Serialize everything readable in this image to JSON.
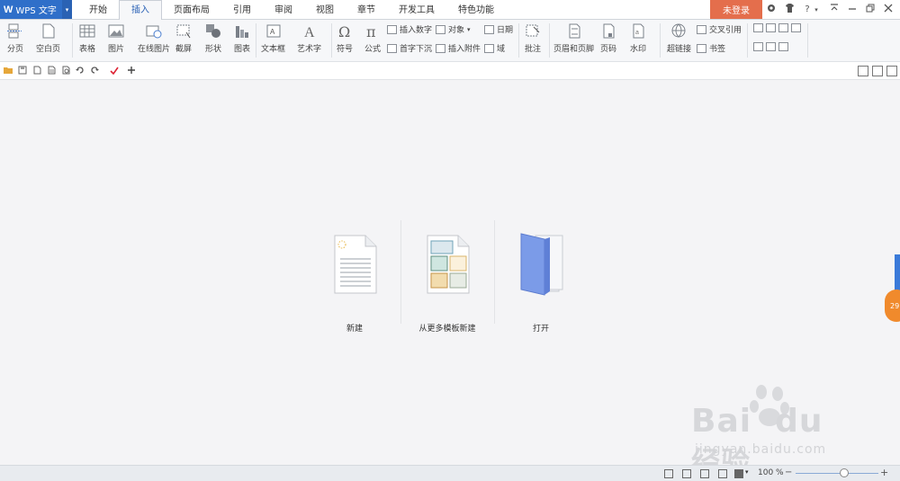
{
  "app": {
    "logo_text": "WPS 文字",
    "logo_w": "W"
  },
  "tabs": [
    "开始",
    "插入",
    "页面布局",
    "引用",
    "审阅",
    "视图",
    "章节",
    "开发工具",
    "特色功能"
  ],
  "login_label": "未登录",
  "title_icons": [
    "?",
    "▾"
  ],
  "ribbon": {
    "page_break": "分页",
    "blank_page": "空白页",
    "table": "表格",
    "picture": "图片",
    "online_picture": "在线图片",
    "screenshot": "截屏",
    "shapes": "形状",
    "chart": "图表",
    "text_box": "文本框",
    "word_art": "艺术字",
    "symbol": "符号",
    "formula": "公式",
    "insert_number": "插入数字",
    "object": "对象",
    "date": "日期",
    "drop_cap": "首字下沉",
    "attachment": "插入附件",
    "field": "域",
    "comment": "批注",
    "header_footer": "页眉和页脚",
    "page_number": "页码",
    "watermark": "水印",
    "hyperlink": "超链接",
    "cross_ref": "交叉引用",
    "bookmark": "书签"
  },
  "start": {
    "new_label": "新建",
    "template_label": "从更多模板新建",
    "open_label": "打开"
  },
  "edge_badge": "29",
  "status": {
    "zoom_text": "100 %",
    "zoom_value": 0.58
  },
  "watermark_brand": "Bai",
  "watermark_brand2": "du",
  "watermark_cn": "经验",
  "watermark_url": "jingyan.baidu.com",
  "colors": {
    "brand": "#2f6fc9",
    "login": "#e46e4c",
    "badge": "#f08a2c",
    "folder": "#7b9be8"
  }
}
